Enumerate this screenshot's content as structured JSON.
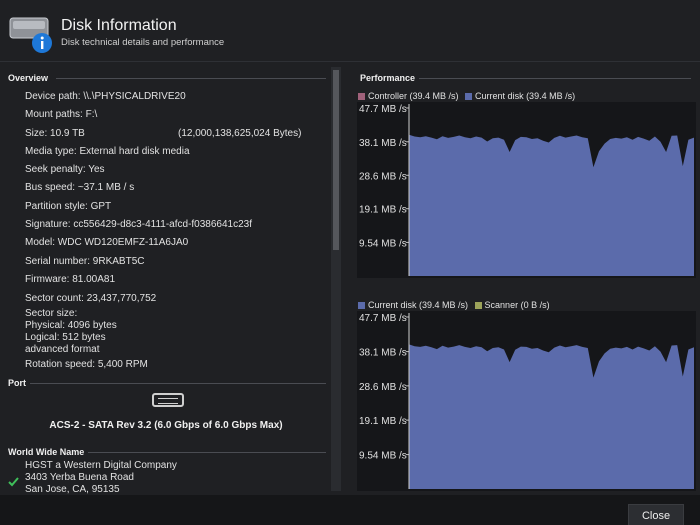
{
  "header": {
    "title": "Disk Information",
    "subtitle": "Disk technical details and performance"
  },
  "overview": {
    "heading": "Overview",
    "rows": [
      "Device path: \\\\.\\PHYSICALDRIVE20",
      "Mount paths: F:\\",
      "Size: 10.9 TB",
      "Media type: External hard disk media",
      "Seek penalty: Yes",
      "Bus speed: ~37.1 MB / s",
      "Partition style: GPT",
      "Signature: cc556429-d8c3-4111-afcd-f0386641c23f",
      "Model: WDC WD120EMFZ-11A6JA0",
      "Serial number: 9RKABT5C",
      "Firmware: 81.00A81",
      "Sector count: 23,437,770,752"
    ],
    "size_bytes": "(12,000,138,625,024 Bytes)",
    "sector_size": [
      "Sector size:",
      "Physical: 4096 bytes",
      "Logical: 512 bytes",
      "advanced format"
    ],
    "rotation": "Rotation speed: 5,400 RPM"
  },
  "port": {
    "heading": "Port",
    "icon": "sata-port-icon",
    "text": "ACS-2 - SATA Rev 3.2 (6.0 Gbps of 6.0 Gbps Max)"
  },
  "wwn": {
    "heading": "World Wide Name",
    "lines": [
      "HGST a Western Digital Company",
      "3403 Yerba Buena Road",
      "San Jose, CA, 95135"
    ]
  },
  "performance": {
    "heading": "Performance"
  },
  "chart_data": [
    {
      "type": "area",
      "legend": [
        {
          "name": "Controller (39.4 MB /s)",
          "color": "#a0617a"
        },
        {
          "name": "Current disk (39.4 MB /s)",
          "color": "#5b6bab"
        }
      ],
      "ytick_labels": [
        "47.7 MB /s",
        "38.1 MB /s",
        "28.6 MB /s",
        "19.1 MB /s",
        "9.54 MB /s"
      ],
      "ylim": [
        0,
        47.7
      ],
      "series": [
        {
          "name": "Current disk (39.4 MB /s)",
          "color": "#5b6bab",
          "values": [
            40.1,
            39.6,
            39.4,
            39.7,
            39.3,
            38.8,
            39.7,
            39.2,
            39.5,
            39.9,
            39.4,
            39.1,
            39.6,
            39.3,
            38.2,
            39.1,
            39.3,
            38.7,
            35.2,
            38.6,
            39.5,
            39.4,
            38.9,
            39.1,
            38.4,
            37.9,
            39.2,
            39.8,
            39.3,
            39.6,
            39.9,
            39.4,
            39.1,
            30.9,
            35.4,
            37.6,
            38.9,
            39.2,
            39.0,
            39.4,
            38.7,
            39.5,
            39.0,
            38.4,
            39.6,
            38.1,
            35.2,
            39.8,
            39.9,
            31.2,
            38.7,
            39.3
          ]
        }
      ]
    },
    {
      "type": "area",
      "legend": [
        {
          "name": "Current disk (39.4 MB /s)",
          "color": "#5b6bab"
        },
        {
          "name": "Scanner (0 B /s)",
          "color": "#9ca35a"
        }
      ],
      "ytick_labels": [
        "47.7 MB /s",
        "38.1 MB /s",
        "28.6 MB /s",
        "19.1 MB /s",
        "9.54 MB /s"
      ],
      "ylim": [
        0,
        47.7
      ],
      "series": [
        {
          "name": "Current disk (39.4 MB /s)",
          "color": "#5b6bab",
          "values": [
            40.1,
            39.6,
            39.4,
            39.7,
            39.3,
            38.8,
            39.7,
            39.2,
            39.5,
            39.9,
            39.4,
            39.1,
            39.6,
            39.3,
            38.2,
            39.1,
            39.3,
            38.7,
            35.2,
            38.6,
            39.5,
            39.4,
            38.9,
            39.1,
            38.4,
            37.9,
            39.2,
            39.8,
            39.3,
            39.6,
            39.9,
            39.4,
            39.1,
            30.9,
            35.4,
            37.6,
            38.9,
            39.2,
            39.0,
            39.4,
            38.7,
            39.5,
            39.0,
            38.4,
            39.6,
            38.1,
            35.2,
            39.8,
            39.9,
            31.2,
            38.7,
            39.3
          ]
        }
      ]
    }
  ],
  "footer": {
    "close_label": "Close"
  }
}
